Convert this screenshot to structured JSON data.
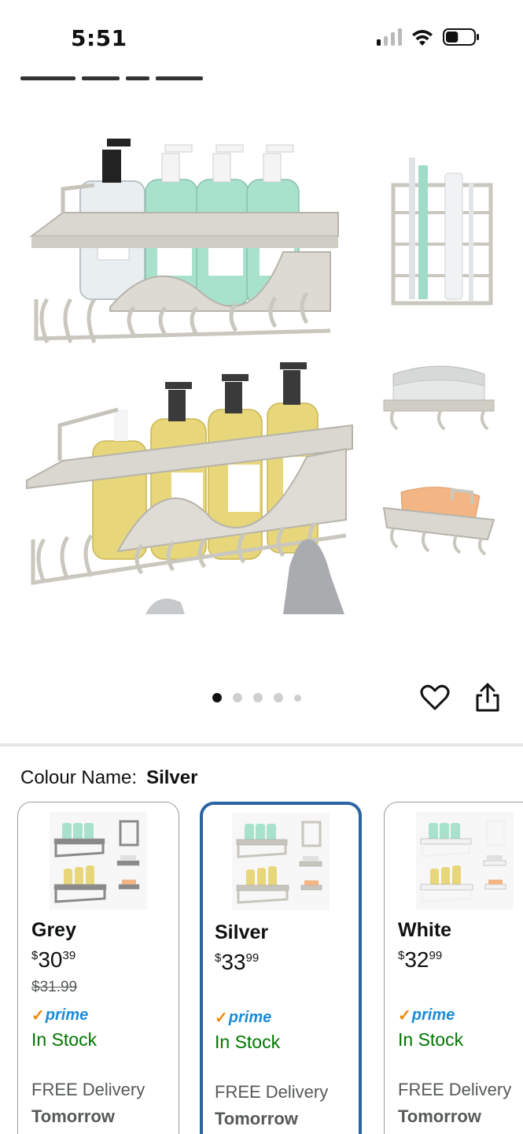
{
  "status_bar": {
    "time": "5:51",
    "battery_level": 0.45
  },
  "carousel": {
    "total": 5,
    "active_index": 0
  },
  "colour": {
    "label": "Colour Name:",
    "value": "Silver"
  },
  "variants": [
    {
      "name": "Grey",
      "currency": "$",
      "whole": "30",
      "fraction": "39",
      "was": "$31.99",
      "prime": "prime",
      "stock": "In Stock",
      "delivery": "FREE Delivery",
      "delivery_day": "Tomorrow",
      "selected": false,
      "rack_color": "#8a8a8a"
    },
    {
      "name": "Silver",
      "currency": "$",
      "whole": "33",
      "fraction": "99",
      "was": "",
      "prime": "prime",
      "stock": "In Stock",
      "delivery": "FREE Delivery",
      "delivery_day": "Tomorrow",
      "selected": true,
      "rack_color": "#c8c6bc"
    },
    {
      "name": "White",
      "currency": "$",
      "whole": "32",
      "fraction": "99",
      "was": "",
      "prime": "prime",
      "stock": "In Stock",
      "delivery": "FREE Delivery",
      "delivery_day": "Tomorrow",
      "selected": false,
      "rack_color": "#f2f2f2"
    }
  ],
  "icons": {
    "wishlist": "heart-icon",
    "share": "share-icon",
    "signal": "signal-icon",
    "wifi": "wifi-icon",
    "battery": "battery-icon"
  }
}
